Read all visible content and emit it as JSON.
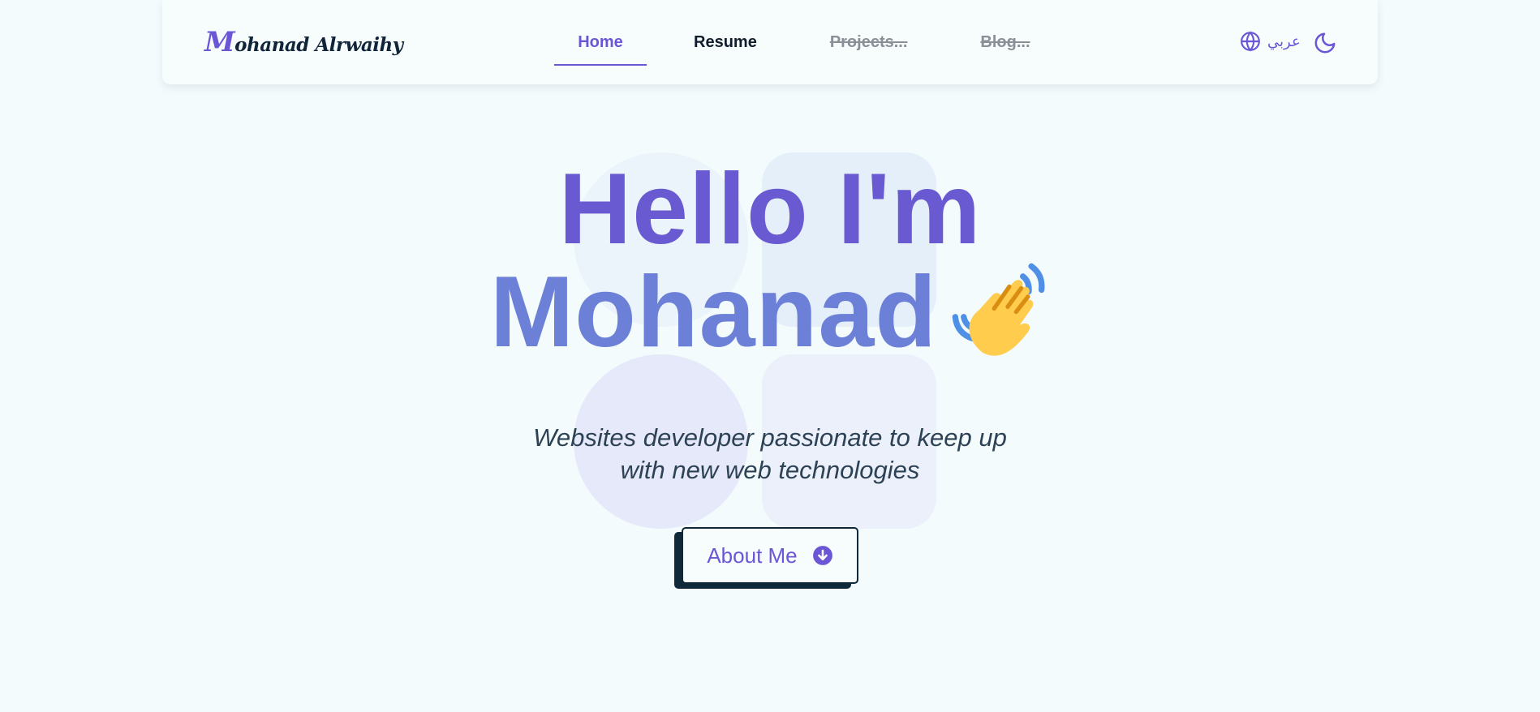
{
  "nav": {
    "logo_initial": "M",
    "logo_rest": "ohanad Alrwaihy",
    "links": [
      {
        "label": "Home",
        "state": "active"
      },
      {
        "label": "Resume",
        "state": "normal"
      },
      {
        "label": "Projects...",
        "state": "disabled"
      },
      {
        "label": "Blog...",
        "state": "disabled"
      }
    ],
    "language_label": "عربي",
    "language_icon": "globe-icon",
    "theme_icon": "moon-icon"
  },
  "hero": {
    "headline_line1": "Hello I'm",
    "headline_line2": "Mohanad",
    "wave_icon": "waving-hand-icon",
    "tagline_line1": "Websites developer passionate to keep up",
    "tagline_line2": "with new web technologies",
    "cta_label": "About Me",
    "cta_icon": "arrow-down-circle-icon"
  },
  "colors": {
    "accent": "#6b57d6",
    "background": "#f3fbfd",
    "dark": "#10293a"
  }
}
